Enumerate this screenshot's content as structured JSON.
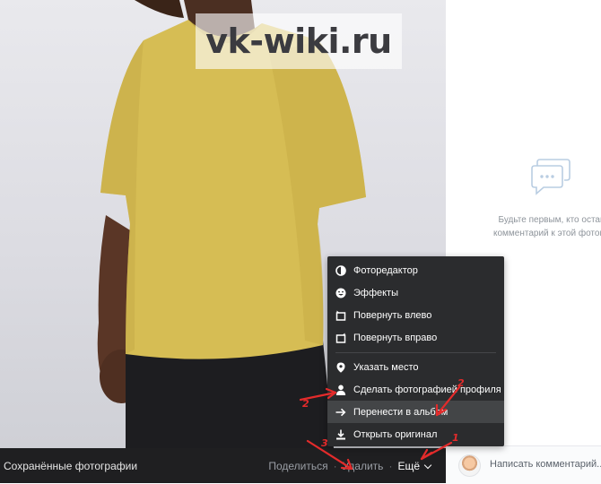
{
  "watermark": {
    "text": "vk-wiki.ru"
  },
  "bottom_bar": {
    "album_title": "Сохранённые фотографии",
    "share_label": "Поделиться",
    "delete_label": "Удалить",
    "more_label": "Ещё",
    "separator": "·"
  },
  "right_panel": {
    "empty_text_line1": "Будьте первым, кто оставит",
    "empty_text_line2": "комментарий к этой фотографии",
    "comment_placeholder": "Написать комментарий..."
  },
  "menu": {
    "items": [
      {
        "label": "Фоторедактор",
        "icon": "contrast-icon"
      },
      {
        "label": "Эффекты",
        "icon": "smile-icon"
      },
      {
        "label": "Повернуть влево",
        "icon": "rotate-left-icon"
      },
      {
        "label": "Повернуть вправо",
        "icon": "rotate-right-icon"
      },
      {
        "label": "Указать место",
        "icon": "location-pin-icon"
      },
      {
        "label": "Сделать фотографией профиля",
        "icon": "user-icon"
      },
      {
        "label": "Перенести в альбом",
        "icon": "arrow-right-icon",
        "highlighted": true
      },
      {
        "label": "Открыть оригинал",
        "icon": "download-icon"
      }
    ]
  },
  "annotations": {
    "numbers": [
      "1",
      "2",
      "3",
      "2"
    ],
    "color": "#e32b2b"
  },
  "colors": {
    "menu_bg": "#2b2c2e",
    "menu_highlight": "#434547",
    "bar_bg": "#1f1f21",
    "shirt": "#d6bd54"
  }
}
